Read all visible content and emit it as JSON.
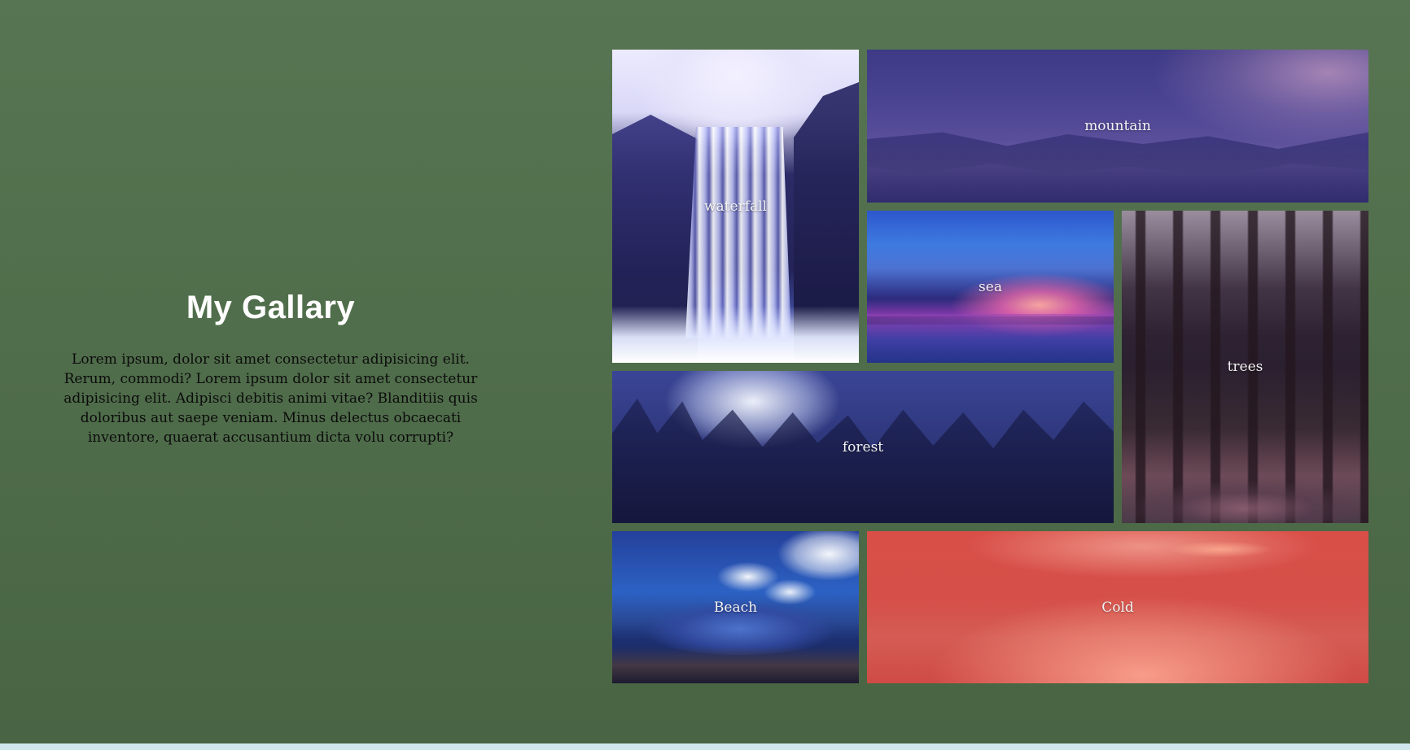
{
  "intro": {
    "title": "My Gallary",
    "description": "Lorem ipsum, dolor sit amet consectetur adipisicing elit. Rerum, commodi? Lorem ipsum dolor sit amet consectetur adipisicing elit. Adipisci debitis animi vitae? Blanditiis quis doloribus aut saepe veniam. Minus delectus obcaecati inventore, quaerat accusantium dicta volu corrupti?"
  },
  "gallery": {
    "tiles": [
      {
        "label": "waterfall"
      },
      {
        "label": "mountain"
      },
      {
        "label": "sea"
      },
      {
        "label": "trees"
      },
      {
        "label": "forest"
      },
      {
        "label": "Beach"
      },
      {
        "label": "Cold"
      }
    ]
  },
  "theme": {
    "background": "#577552",
    "bottom_strip": "#cfe7ec"
  }
}
